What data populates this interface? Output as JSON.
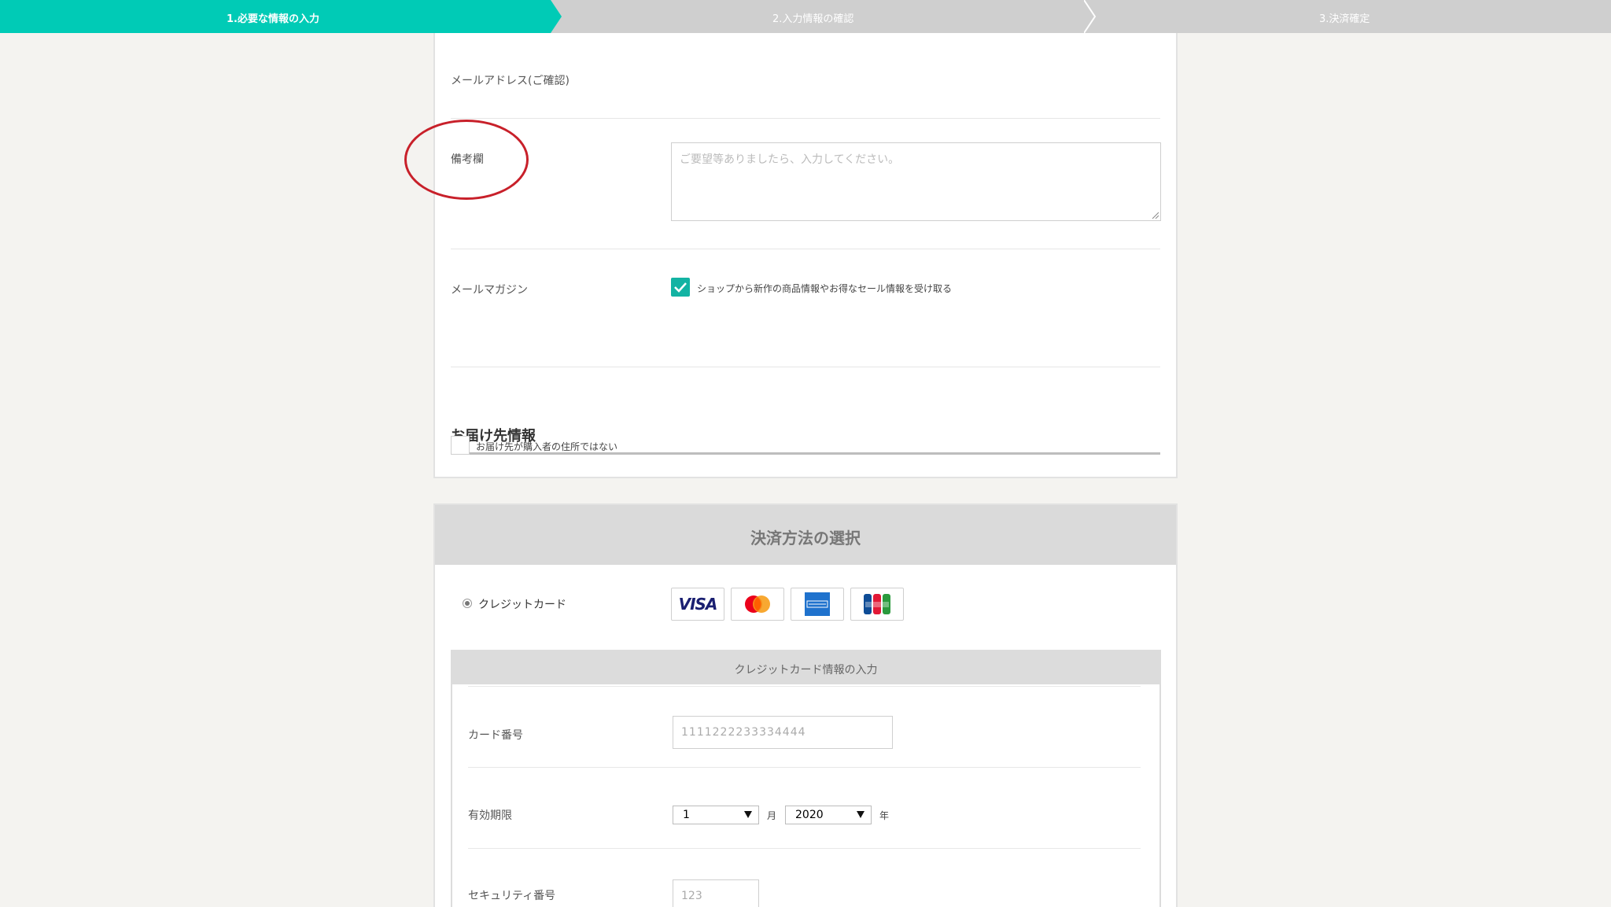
{
  "steps": {
    "step1": "1.必要な情報の入力",
    "step2": "2.入力情報の確認",
    "step3": "3.決済確定"
  },
  "colors": {
    "accent": "#00cbb6",
    "checkbox": "#13b3a3",
    "annotation": "#c8202a"
  },
  "form": {
    "email_confirm_label": "メールアドレス(ご確認)",
    "remarks_label": "備考欄",
    "remarks_placeholder": "ご要望等ありましたら、入力してください。",
    "newsletter_label": "メールマガジン",
    "newsletter_checked": true,
    "newsletter_text": "ショップから新作の商品情報やお得なセール情報を受け取る",
    "delivery_heading": "お届け先情報",
    "delivery_checkbox_text": "お届け先が購入者の住所ではない",
    "delivery_checked": false
  },
  "payment": {
    "title": "決済方法の選択",
    "method_label": "クレジットカード",
    "brands": [
      "visa-logo",
      "mastercard-logo",
      "amex-logo",
      "jcb-logo"
    ],
    "visa_text": "VISA",
    "card_panel_title": "クレジットカード情報の入力",
    "card_number_label": "カード番号",
    "card_number_placeholder": "1111222233334444",
    "expiry_label": "有効期限",
    "expiry_month": "1",
    "month_unit": "月",
    "expiry_year": "2020",
    "year_unit": "年",
    "security_label": "セキュリティ番号",
    "security_placeholder": "123"
  }
}
